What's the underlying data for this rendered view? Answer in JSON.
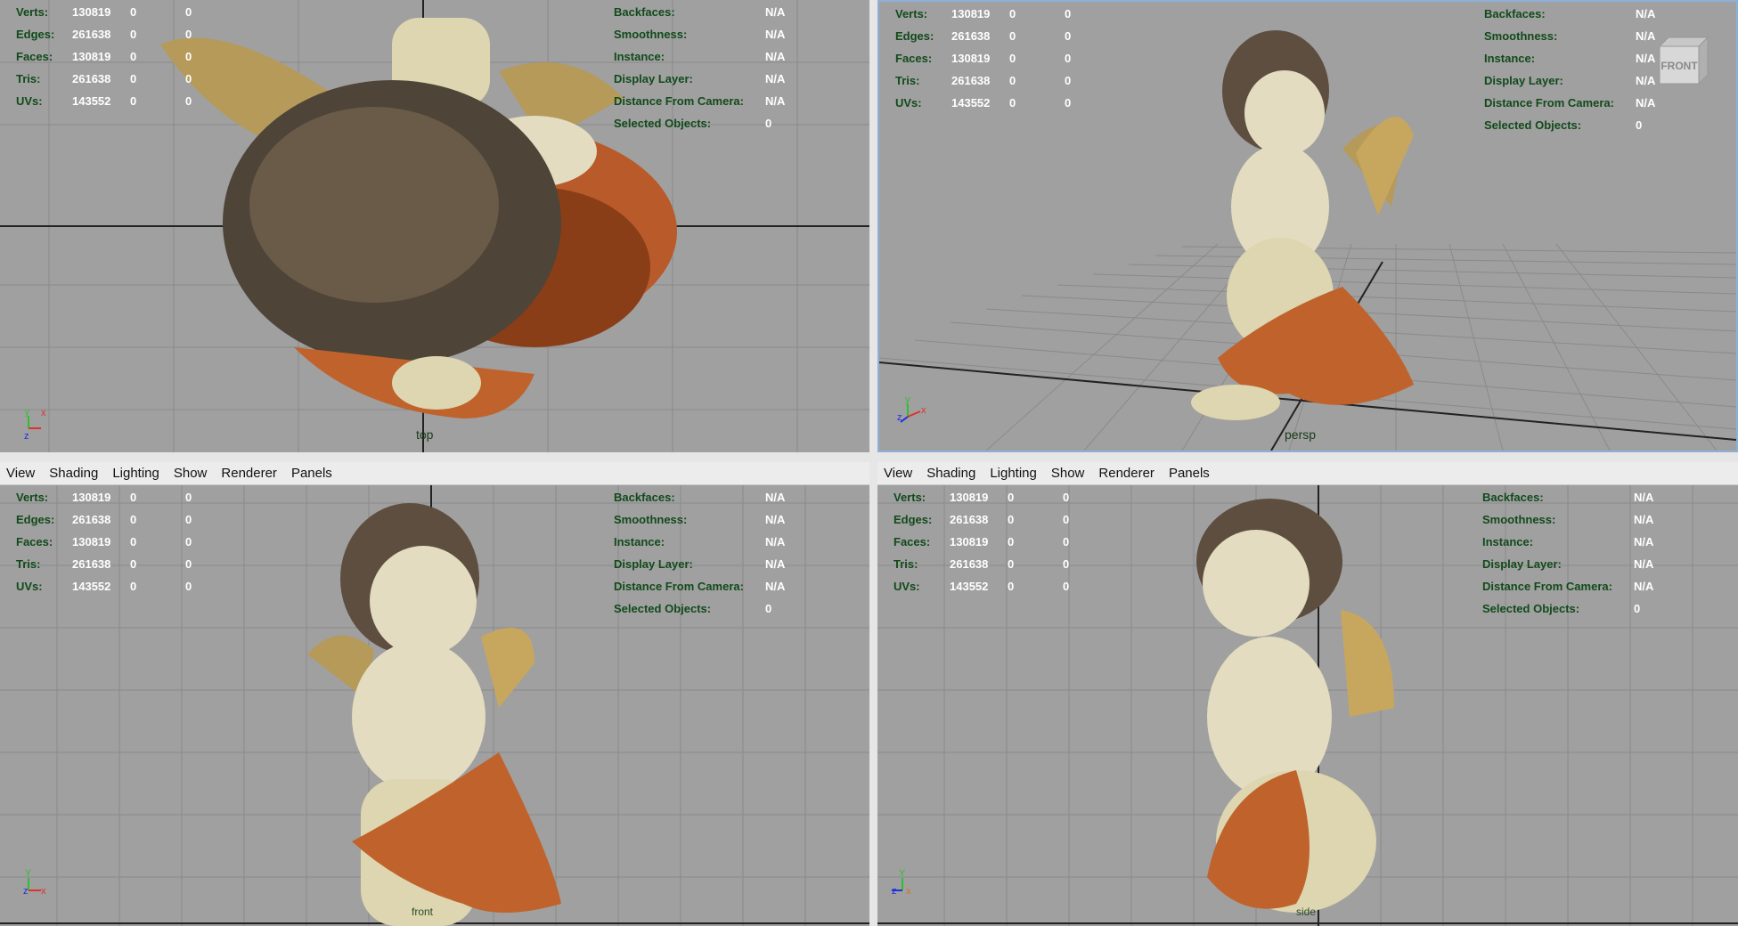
{
  "menu": [
    "View",
    "Shading",
    "Lighting",
    "Show",
    "Renderer",
    "Panels"
  ],
  "stats": [
    {
      "label": "Verts:",
      "v1": "130819",
      "v2": "0",
      "v3": "0"
    },
    {
      "label": "Edges:",
      "v1": "261638",
      "v2": "0",
      "v3": "0"
    },
    {
      "label": "Faces:",
      "v1": "130819",
      "v2": "0",
      "v3": "0"
    },
    {
      "label": "Tris:",
      "v1": "261638",
      "v2": "0",
      "v3": "0"
    },
    {
      "label": "UVs:",
      "v1": "143552",
      "v2": "0",
      "v3": "0"
    }
  ],
  "info": [
    {
      "label": "Backfaces:",
      "val": "N/A"
    },
    {
      "label": "Smoothness:",
      "val": "N/A"
    },
    {
      "label": "Instance:",
      "val": "N/A"
    },
    {
      "label": "Display Layer:",
      "val": "N/A"
    },
    {
      "label": "Distance From Camera:",
      "val": "N/A"
    },
    {
      "label": "Selected Objects:",
      "val": "0"
    }
  ],
  "viewports": {
    "top": {
      "camera": "top"
    },
    "persp": {
      "camera": "persp",
      "viewcube": "FRONT"
    },
    "front": {
      "camera": "front"
    },
    "side": {
      "camera": "side"
    }
  },
  "colors": {
    "viewport_bg": "#a0a0a0",
    "hud_label": "#114a1a",
    "hud_value": "#ffffff",
    "active_border": "#8fb0d6"
  }
}
